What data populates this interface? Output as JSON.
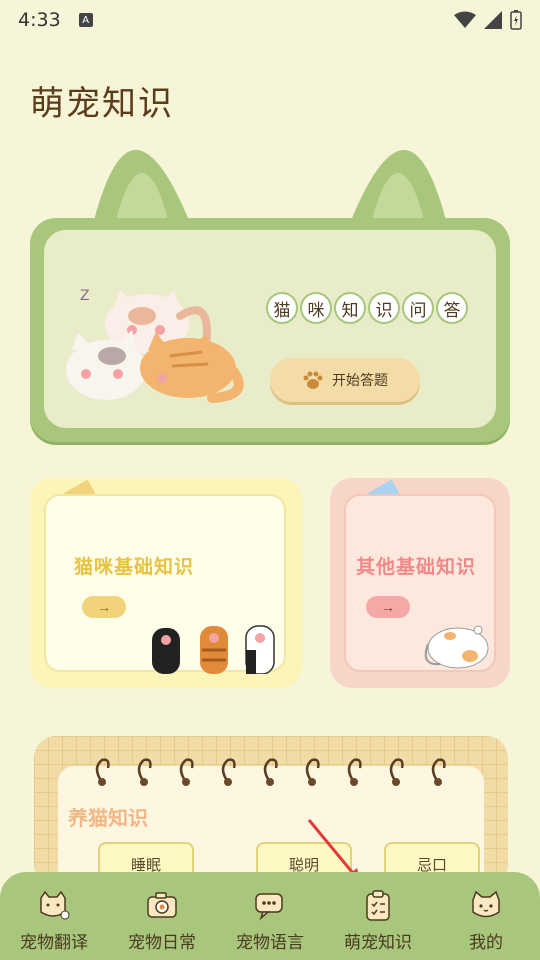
{
  "status_bar": {
    "time": "4:33",
    "notification_icon": "A"
  },
  "page": {
    "title": "萌宠知识"
  },
  "hero": {
    "quiz_chars": [
      "猫",
      "咪",
      "知",
      "识",
      "问",
      "答"
    ],
    "start_button": "开始答题",
    "sleep_text": "Z"
  },
  "cards": {
    "cat_basics": {
      "title": "猫咪基础知识",
      "arrow": "→"
    },
    "other_basics": {
      "title": "其他基础知识",
      "arrow": "→"
    }
  },
  "notebook": {
    "title": "养猫知识",
    "topics": [
      "睡眠",
      "聪明",
      "忌口"
    ]
  },
  "bottom_nav": {
    "items": [
      {
        "label": "宠物翻译",
        "icon": "cat-translate-icon"
      },
      {
        "label": "宠物日常",
        "icon": "camera-icon"
      },
      {
        "label": "宠物语言",
        "icon": "chat-bubble-icon"
      },
      {
        "label": "萌宠知识",
        "icon": "clipboard-icon",
        "active": true
      },
      {
        "label": "我的",
        "icon": "cat-face-icon"
      }
    ]
  },
  "colors": {
    "background": "#f6f5d8",
    "green": "#a8c67c",
    "yellow_title": "#e8c243",
    "pink_title": "#f08a8a",
    "red_arrow": "#e23b3b"
  }
}
